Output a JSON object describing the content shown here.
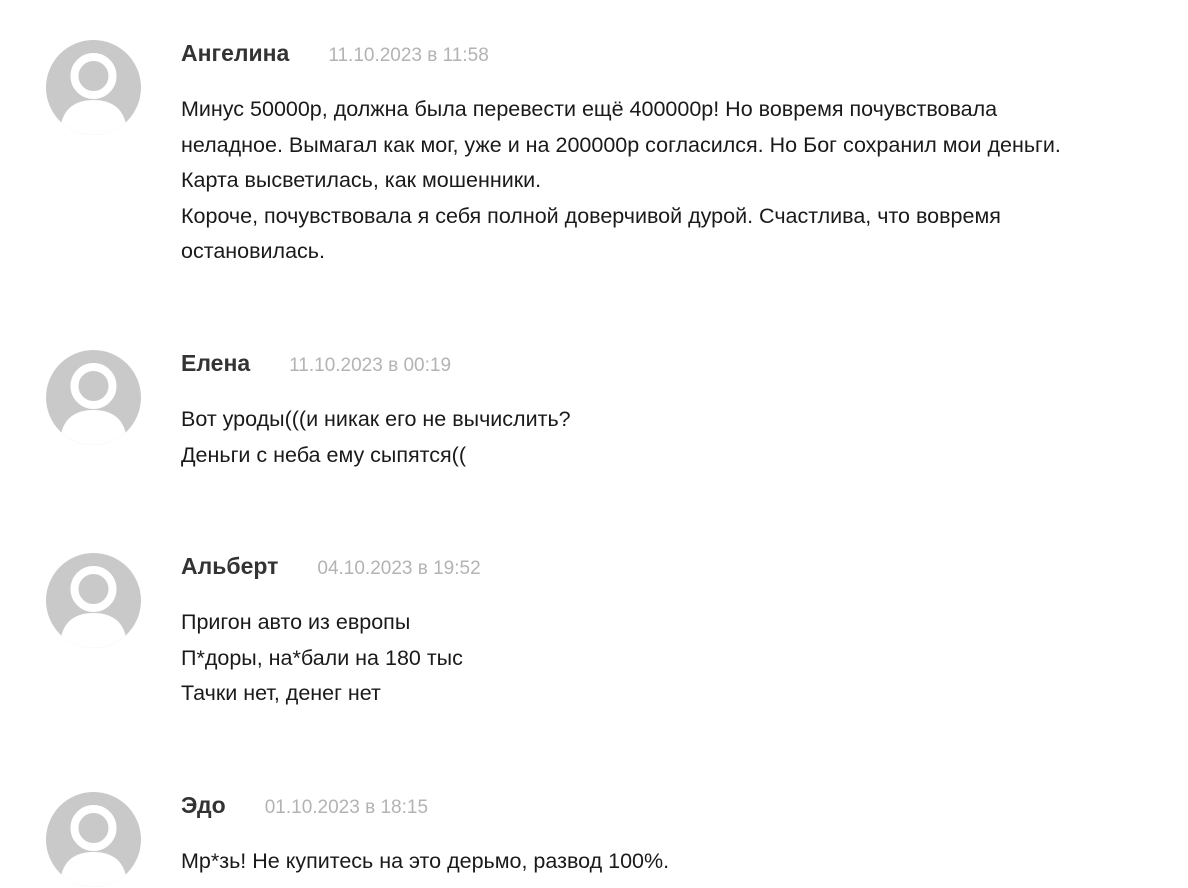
{
  "comments": [
    {
      "author": "Ангелина",
      "date": "11.10.2023 в 11:58",
      "lines": [
        "Минус 50000р, должна была перевести ещё 400000р! Но вовремя почувствовала",
        "неладное. Вымагал как мог, уже и на 200000р согласился. Но Бог сохранил мои деньги.",
        "Карта высветилась, как мошенники.",
        "Короче, почувствовала я себя полной доверчивой дурой. Счастлива, что вовремя",
        "остановилась."
      ]
    },
    {
      "author": "Елена",
      "date": "11.10.2023 в 00:19",
      "lines": [
        "Вот уроды(((и никак его не вычислить?",
        "Деньги с неба ему сыпятся(("
      ]
    },
    {
      "author": "Альберт",
      "date": "04.10.2023 в 19:52",
      "lines": [
        "Пригон авто из европы",
        "П*доры, на*бали на 180 тыс",
        "Тачки нет, денег нет"
      ]
    },
    {
      "author": "Эдо",
      "date": "01.10.2023 в 18:15",
      "lines": [
        "Мр*зь! Не купитесь на это дерьмо, развод 100%."
      ]
    }
  ],
  "avatar_icon": "default-user-avatar-icon",
  "colors": {
    "avatar_bg": "#c9c9c9",
    "avatar_figure": "#ffffff",
    "author": "#333333",
    "date": "#b3b3b3",
    "text": "#1a1a1a"
  }
}
